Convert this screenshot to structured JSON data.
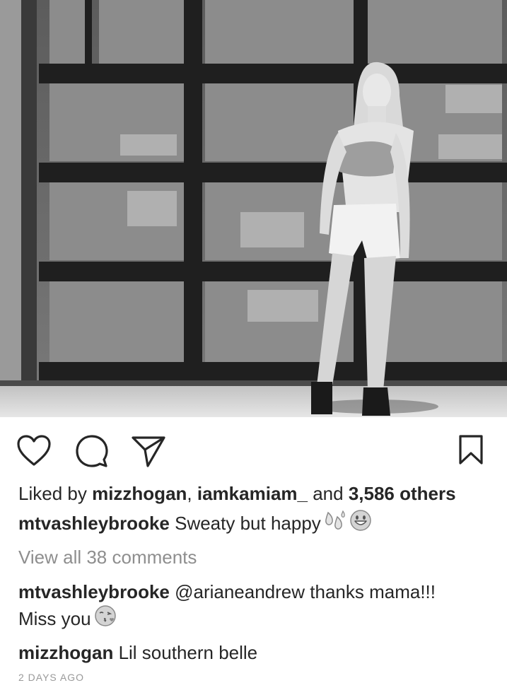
{
  "post": {
    "photo_alt": "",
    "icons": {
      "like": "heart-icon",
      "comment": "comment-bubble-icon",
      "share": "paper-plane-icon",
      "save": "bookmark-icon"
    },
    "likes": {
      "prefix": "Liked by ",
      "user1": "mizzhogan",
      "sep": ", ",
      "user2": "iamkamiam_",
      "and": " and ",
      "others": "3,586 others"
    },
    "caption": {
      "username": "mtvashleybrooke",
      "text": " Sweaty but happy",
      "emojis": [
        "sweat-droplets-icon",
        "grinning-face-icon"
      ]
    },
    "view_comments": "View all 38 comments",
    "comments": [
      {
        "username": "mtvashleybrooke",
        "text_line1": " @arianeandrew thanks mama!!!",
        "text_line2": "Miss you",
        "emoji": "face-blowing-kiss-icon"
      },
      {
        "username": "mizzhogan",
        "text": " Lil southern belle"
      }
    ],
    "timestamp": "2 DAYS AGO"
  }
}
